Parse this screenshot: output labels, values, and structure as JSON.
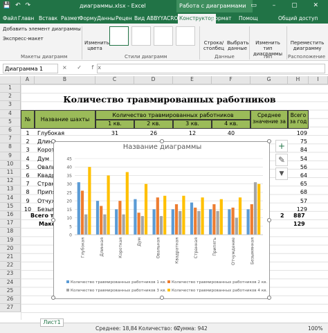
{
  "titlebar": {
    "quick_access": "💾 ↶ ↷",
    "document": "диаграммы.xlsx - Excel",
    "context_tab": "Работа с диаграммами",
    "window_controls": "▭ – ▢ ✕"
  },
  "tabs": [
    "Файл",
    "Главн",
    "Вставк",
    "Размет",
    "Форму",
    "Данны",
    "Рецен",
    "Вид",
    "ABBYY",
    "ACROE",
    "Конструктор",
    "Формат",
    "Помощ",
    "Общий доступ"
  ],
  "ribbon": {
    "add_element": "Добавить элемент диаграммы",
    "express_layout": "Экспресс-макет",
    "group_layouts": "Макеты диаграмм",
    "change_colors": "Изменить цвета",
    "group_styles": "Стили диаграмм",
    "switch_row_col": "Строка/ столбец",
    "select_data": "Выбрать данные",
    "group_data": "Данные",
    "change_type": "Изменить тип диаграммы",
    "group_type": "Тип",
    "move_chart": "Переместить диаграмму",
    "group_location": "Расположение"
  },
  "formula": {
    "name_box": "Диаграмма 1",
    "fx": "× ✓ fx"
  },
  "columns": [
    "A",
    "B",
    "C",
    "D",
    "E",
    "F",
    "G",
    "H",
    "I"
  ],
  "rows": [
    "1",
    "2",
    "3",
    "4",
    "5",
    "6",
    "7",
    "8",
    "9",
    "10",
    "11",
    "12",
    "13",
    "14",
    "15",
    "16",
    "17",
    "18",
    "19",
    "20",
    "21",
    "22",
    "23",
    "24",
    "25",
    "26",
    "27"
  ],
  "sheet": {
    "title": "Количество травмированных работников",
    "col_no": "№",
    "col_name": "Название шахты",
    "col_group": "Количество травмированных работников",
    "quarters": [
      "1 кв.",
      "2 кв.",
      "3 кв.",
      "4 кв."
    ],
    "col_avg": "Среднее значение за",
    "col_total": "Всего за год",
    "first_row": {
      "no": "1",
      "name": "Глубокая",
      "q1": "31",
      "q2": "26",
      "q3": "12",
      "q4": "40",
      "total": "109"
    },
    "row_nums": [
      "1",
      "2",
      "3",
      "4",
      "5",
      "6",
      "7",
      "8",
      "9",
      "10"
    ],
    "row_names": [
      "Глубокая",
      "Длинн",
      "Корот",
      "Дум",
      "Овальн",
      "Квадрат",
      "Стран",
      "Припя",
      "Отчуж",
      "Безым"
    ],
    "totals_col": [
      "109",
      "75",
      "84",
      "54",
      "56",
      "64",
      "65",
      "68",
      "57",
      "129"
    ],
    "sum_label": "Всего тр",
    "max_label": "Макс",
    "sum_avg": "2",
    "sum_total": "887",
    "max_total": "129"
  },
  "chart_data": {
    "type": "bar",
    "title": "Название диаграммы",
    "categories": [
      "Глубокая",
      "Длинная",
      "Короткая",
      "Дум",
      "Овальная",
      "Квадратная",
      "Странная",
      "Припять",
      "Отчуждение",
      "Безымянная"
    ],
    "ylim": [
      0,
      45
    ],
    "yticks": [
      0,
      5,
      10,
      15,
      20,
      25,
      30,
      35,
      40,
      45
    ],
    "grid": true,
    "legend_position": "bottom",
    "series": [
      {
        "name": "Количество травмированных работников 1 кв.",
        "color": "#5b9bd5",
        "values": [
          31,
          20,
          15,
          21,
          15,
          15,
          19,
          15,
          15,
          15
        ]
      },
      {
        "name": "Количество травмированных работников 2 кв.",
        "color": "#ed7d31",
        "values": [
          26,
          17,
          20,
          13,
          22,
          18,
          16,
          18,
          16,
          18
        ]
      },
      {
        "name": "Количество травмированных работников 3 кв.",
        "color": "#a5a5a5",
        "values": [
          12,
          12,
          12,
          11,
          11,
          14,
          14,
          14,
          10,
          31
        ]
      },
      {
        "name": "Количество травмированных работников 4 кв.",
        "color": "#ffc000",
        "values": [
          40,
          35,
          37,
          30,
          23,
          23,
          22,
          21,
          22,
          30
        ]
      }
    ]
  },
  "chart_tools": {
    "plus": "+",
    "brush": "✎",
    "filter": "▼"
  },
  "status": {
    "sheet_tab": "Лист1",
    "average": "Среднее: 18,84",
    "count": "Количество: 67",
    "sum": "Сумма: 942",
    "zoom": "100%"
  }
}
